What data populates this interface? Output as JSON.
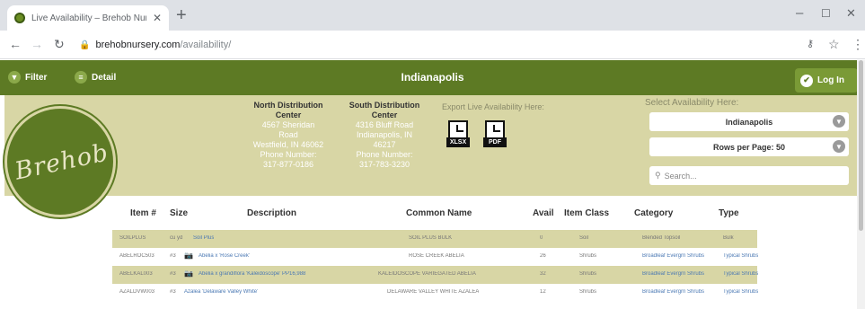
{
  "browser": {
    "tab_title": "Live Availability – Brehob Nurser",
    "url_host": "brehobnursery.com",
    "url_path": "/availability/"
  },
  "site": {
    "filter_label": "Filter",
    "detail_label": "Detail",
    "title": "Indianapolis",
    "login_label": "Log In",
    "logo_text": "Brehob"
  },
  "locations": {
    "north": {
      "head": "North Distribution Center",
      "line1": "4567 Sheridan",
      "line2": "Road",
      "line3": "Westfield, IN 46062",
      "line4": "Phone Number:",
      "line5": "317-877-0186"
    },
    "south": {
      "head": "South Distribution Center",
      "line1": "4316 Bluff Road",
      "line2": "Indianapolis, IN",
      "line3": "46217",
      "line4": "Phone Number:",
      "line5": "317-783-3230"
    }
  },
  "export": {
    "title": "Export Live Availability Here:",
    "xlsx_label": "XLSX",
    "pdf_label": "PDF"
  },
  "selector": {
    "title": "Select Availability Here:",
    "location_value": "Indianapolis",
    "rows_value": "Rows per Page: 50",
    "search_placeholder": "Search..."
  },
  "table": {
    "headers": [
      "Item #",
      "Size",
      "Description",
      "Common Name",
      "Avail",
      "Item Class",
      "Category",
      "Type"
    ],
    "rows": [
      {
        "item": "SOILPLUS",
        "size": "cu yd",
        "description": "Soil Plus",
        "common": "SOIL PLUS BULK",
        "avail": "0",
        "class": "Soil",
        "category": "Blended Topsoil",
        "type": "Bulk",
        "camera": false
      },
      {
        "item": "ABELROC503",
        "size": "#3",
        "description": "Abelia x 'Rose Creek'",
        "common": "ROSE CREEK ABELIA",
        "avail": "26",
        "class": "Shrubs",
        "category": "Broadleaf Evergrn Shrubs",
        "type": "Typical Shrubs",
        "camera": true
      },
      {
        "item": "ABELKAL003",
        "size": "#3",
        "description": "Abelia x grandiflora 'Kaleidoscope' PP16,988",
        "common": "KALEIDOSCOPE VARIEGATED ABELIA",
        "avail": "32",
        "class": "Shrubs",
        "category": "Broadleaf Evergrn Shrubs",
        "type": "Typical Shrubs",
        "camera": true
      },
      {
        "item": "AZALDVW003",
        "size": "#3",
        "description": "Azalea 'Delaware Valley White'",
        "common": "DELAWARE VALLEY WHITE AZALEA",
        "avail": "12",
        "class": "Shrubs",
        "category": "Broadleaf Evergrn Shrubs",
        "type": "Typical Shrubs",
        "camera": false
      }
    ]
  },
  "colors": {
    "brand_green": "#5d7a24",
    "panel_tan": "#d8d6a5",
    "link_blue": "#4a78b3"
  }
}
